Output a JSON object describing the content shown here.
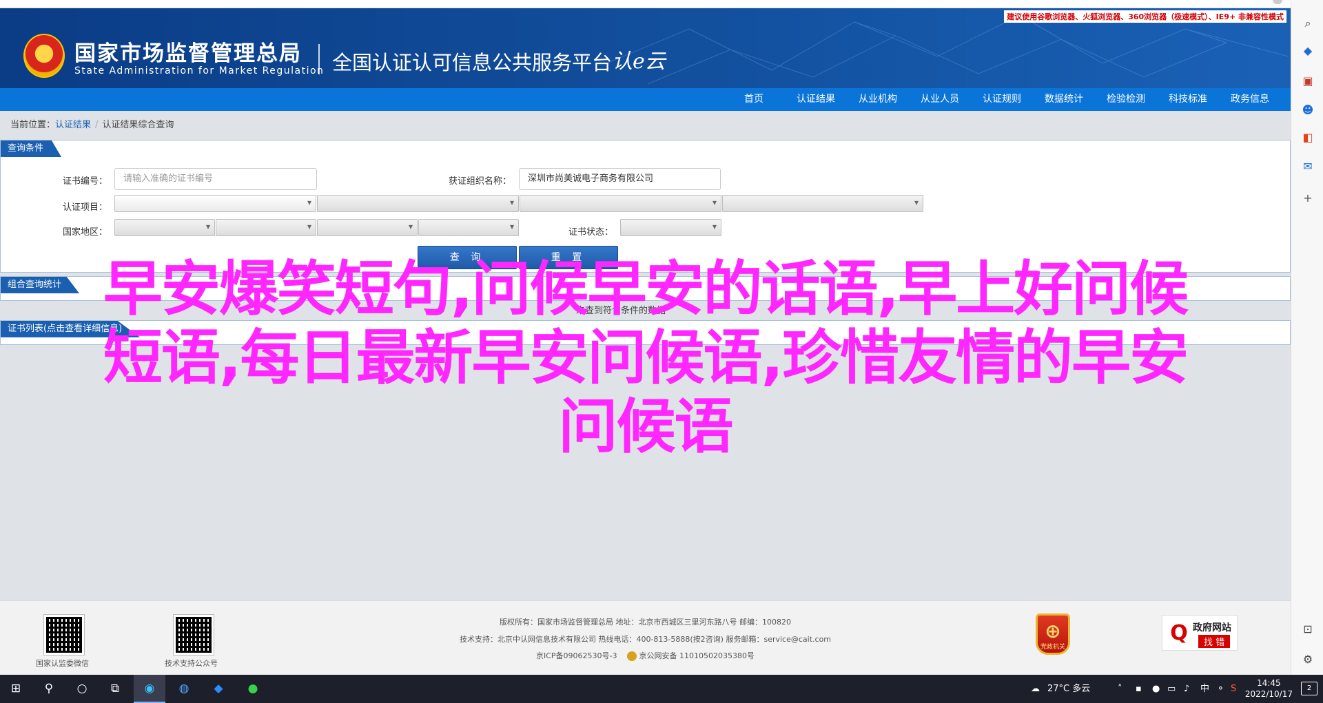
{
  "header": {
    "compat_notice": "建议使用谷歌浏览器、火狐浏览器、360浏览器（极速模式）、IE9+ 非兼容性模式",
    "org_cn": "国家市场监督管理总局",
    "org_en": "State Administration  for  Market Regulation",
    "platform": "全国认证认可信息公共服务平台",
    "platform_logo": "认e云"
  },
  "nav": {
    "items": [
      "首页",
      "认证结果",
      "从业机构",
      "从业人员",
      "认证规则",
      "数据统计",
      "检验检测",
      "科技标准",
      "政务信息"
    ]
  },
  "breadcrumb": {
    "prefix": "当前位置：",
    "link": "认证结果",
    "separator": "/",
    "current": "认证结果综合查询"
  },
  "query": {
    "panel_title": "查询条件",
    "cert_no_label": "证书编号：",
    "cert_no_placeholder": "请输入准确的证书编号",
    "org_label": "获证组织名称：",
    "org_value": "深圳市尚美诚电子商务有限公司",
    "project_label": "认证项目：",
    "region_label": "国家地区：",
    "status_label": "证书状态：",
    "search_button": "查 询",
    "reset_button": "重 置"
  },
  "stats": {
    "panel_title": "组合查询统计",
    "text": "未查到符合条件的数据"
  },
  "list": {
    "panel_title": "证书列表(点击查看详细信息)"
  },
  "overlay": {
    "line1": "早安爆笑短句,问候早安的话语,早上好问候",
    "line2": "短语,每日最新早安问候语,珍惜友情的早安",
    "line3": "问候语",
    "color": "#ff26ff"
  },
  "footer": {
    "qr1_caption": "国家认监委微信",
    "qr2_caption": "技术支持公众号",
    "line1": "版权所有：国家市场监督管理总局    地址：北京市西城区三里河东路八号    邮编：100820",
    "line2": "技术支持：北京中认网信息技术有限公司    热线电话：400-813-5888(按2咨询)    服务邮箱：service@cait.com",
    "icp": "京ICP备09062530号-3",
    "police": "京公网安备 11010502035380号",
    "badge_caption": "党政机关",
    "gov_title": "政府网站",
    "gov_sub": "找 错"
  },
  "sidebar_icons": [
    "search-icon",
    "tag-icon",
    "toolbox-icon",
    "user-icon",
    "office-icon",
    "outlook-icon",
    "add-icon",
    "layout-icon",
    "settings-icon"
  ],
  "taskbar": {
    "weather": "27°C  多云",
    "ime": "中",
    "time": "14:45",
    "date": "2022/10/17",
    "notifications": "2"
  }
}
